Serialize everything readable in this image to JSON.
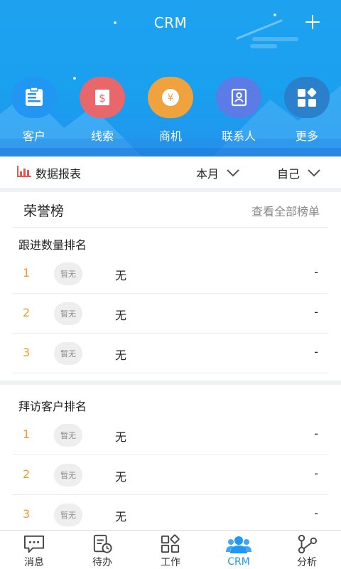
{
  "header": {
    "title": "CRM",
    "add_icon": "plus-icon",
    "background_color": "#1ea2f0"
  },
  "menu": [
    {
      "label": "客户",
      "icon": "customer-icon",
      "color": "#2196f3"
    },
    {
      "label": "线索",
      "icon": "lead-icon",
      "color": "#e8676b"
    },
    {
      "label": "商机",
      "icon": "opportunity-icon",
      "color": "#f0a33d"
    },
    {
      "label": "联系人",
      "icon": "contact-icon",
      "color": "#5b7be6"
    },
    {
      "label": "更多",
      "icon": "more-icon",
      "color": "#2b80cc"
    }
  ],
  "filter": {
    "report_label": "数据报表",
    "report_icon": "bar-chart-icon",
    "period": "本月",
    "scope": "自己"
  },
  "honor": {
    "title": "荣誉榜",
    "view_all": "查看全部榜单"
  },
  "sections": [
    {
      "title": "跟进数量排名",
      "rows": [
        {
          "rank": "1",
          "avatar": "暂无",
          "name": "无",
          "value": "-"
        },
        {
          "rank": "2",
          "avatar": "暂无",
          "name": "无",
          "value": "-"
        },
        {
          "rank": "3",
          "avatar": "暂无",
          "name": "无",
          "value": "-"
        }
      ]
    },
    {
      "title": "拜访客户排名",
      "rows": [
        {
          "rank": "1",
          "avatar": "暂无",
          "name": "无",
          "value": "-"
        },
        {
          "rank": "2",
          "avatar": "暂无",
          "name": "无",
          "value": "-"
        },
        {
          "rank": "3",
          "avatar": "暂无",
          "name": "无",
          "value": "-"
        }
      ]
    }
  ],
  "tabbar": {
    "active_color": "#2196f3",
    "tabs": [
      {
        "label": "消息",
        "icon": "message-icon"
      },
      {
        "label": "待办",
        "icon": "todo-icon"
      },
      {
        "label": "工作",
        "icon": "work-icon"
      },
      {
        "label": "CRM",
        "icon": "crm-icon",
        "active": true
      },
      {
        "label": "分析",
        "icon": "analysis-icon"
      }
    ]
  }
}
